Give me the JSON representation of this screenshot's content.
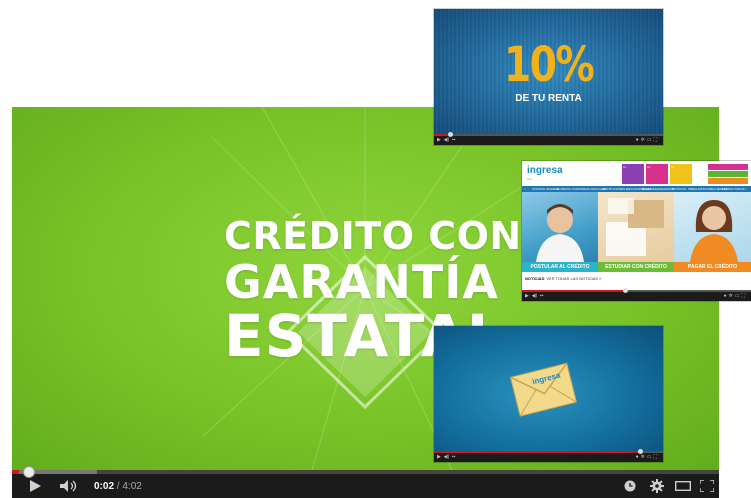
{
  "main_player": {
    "headline": {
      "line1": "CRÉDITO CON",
      "line2": "GARANTÍA",
      "line3": "ESTATAL"
    },
    "time_current": "0:02",
    "time_separator": " / ",
    "time_total": "4:02",
    "progress_played": 0.01,
    "progress_loaded": 0.12,
    "icons": [
      "play-icon",
      "volume-icon",
      "watch-later-icon",
      "settings-gear-icon",
      "theater-mode-icon",
      "fullscreen-icon"
    ]
  },
  "thumbnail_1": {
    "big_text": "10%",
    "sub_text": "DE TU RENTA",
    "progress_played": 0.07
  },
  "thumbnail_2": {
    "logo": "ingresa",
    "nav_items": [
      "CONOCE INGRESA",
      "ALUMNOS",
      "COMUNIDAD ESCOLAR",
      "INSTITUCIONES EDUCACIONALES",
      "BANCOS",
      "EGRESADOS",
      "NOTICIAS",
      "PREGUNTAS FRECUENTES",
      "CONTACTANOS"
    ],
    "cta_1": "POSTULAR AL CRÉDITO",
    "cta_2": "ESTUDIAR CON CRÉDITO",
    "cta_3": "PAGAR EL CRÉDITO",
    "notices_label": "NOTICIAS",
    "notices_link": "VER TODAS LAS NOTICIAS »",
    "progress_played": 0.45,
    "colors": {
      "brand_blue": "#1a8ac2",
      "tile_pink": "#d6308f",
      "tile_purple": "#8b3fb3",
      "tile_yellow": "#f1c21a",
      "tile_green": "#5bb432",
      "cta_teal": "#2bb3c9",
      "cta_green": "#6abd35",
      "cta_orange": "#f08a22"
    }
  },
  "thumbnail_3": {
    "envelope_logo": "ingresa",
    "progress_played": 0.9
  },
  "colors": {
    "main_green": "#78c328",
    "progress_red": "#cc181e",
    "control_bar": "#1b1b1b"
  }
}
